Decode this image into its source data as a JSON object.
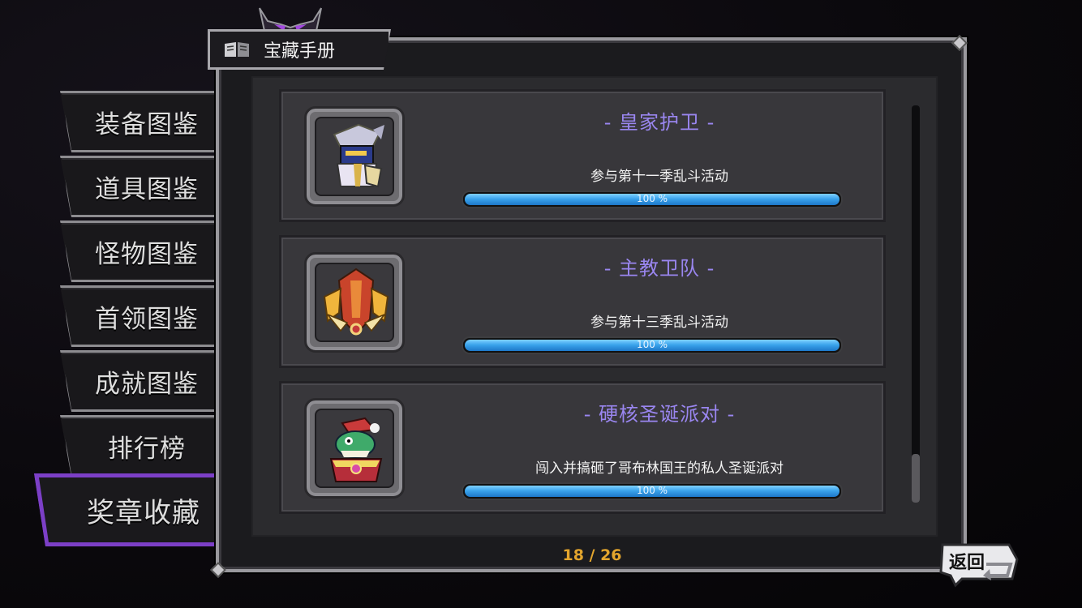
{
  "panel": {
    "title": "宝藏手册",
    "page_counter": "18 / 26",
    "back_label": "返回"
  },
  "tabs": [
    {
      "label": "装备图鉴",
      "active": false
    },
    {
      "label": "道具图鉴",
      "active": false
    },
    {
      "label": "怪物图鉴",
      "active": false
    },
    {
      "label": "首领图鉴",
      "active": false
    },
    {
      "label": "成就图鉴",
      "active": false
    },
    {
      "label": "排行榜",
      "active": false
    },
    {
      "label": "奖章收藏",
      "active": true
    }
  ],
  "medals": [
    {
      "title": "- 皇家护卫 -",
      "description": "参与第十一季乱斗活动",
      "progress_text": "100 %",
      "progress": 1.0,
      "icon": "royal-guard-knight-icon"
    },
    {
      "title": "- 主教卫队 -",
      "description": "参与第十三季乱斗活动",
      "progress_text": "100 %",
      "progress": 1.0,
      "icon": "bishop-guard-crest-icon"
    },
    {
      "title": "- 硬核圣诞派对 -",
      "description": "闯入并搞砸了哥布林国王的私人圣诞派对",
      "progress_text": "100 %",
      "progress": 1.0,
      "icon": "christmas-goblin-king-icon"
    }
  ],
  "colors": {
    "accent_purple": "#8b4bd6",
    "title_text": "#9a86f0",
    "progress_blue": "#3ba4ec",
    "page_counter": "#e3a52d"
  }
}
